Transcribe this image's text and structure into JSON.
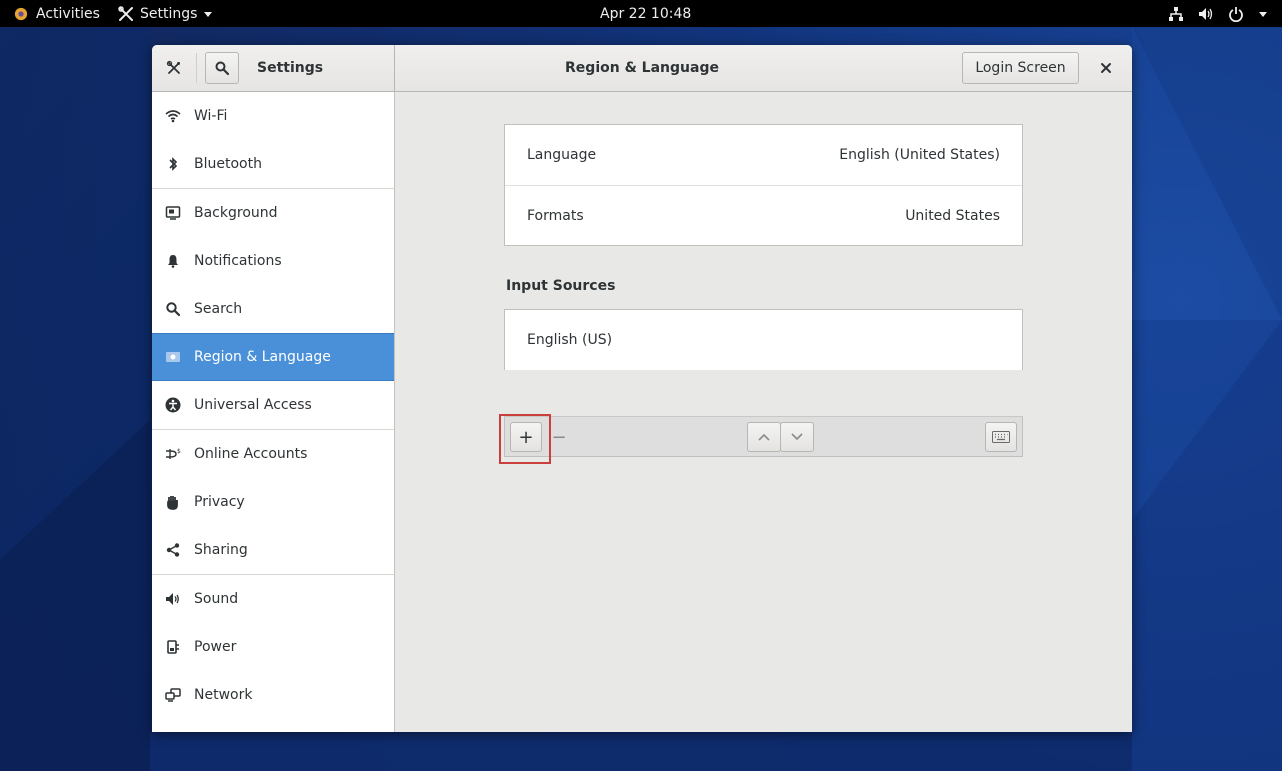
{
  "topbar": {
    "activities": "Activities",
    "app_menu": "Settings",
    "clock": "Apr 22  10:48"
  },
  "window": {
    "sidebar_title": "Settings",
    "panel_title": "Region & Language",
    "login_button": "Login Screen",
    "close_glyph": "×"
  },
  "sidebar": {
    "items": [
      {
        "label": "Wi-Fi",
        "icon": "wifi-icon"
      },
      {
        "label": "Bluetooth",
        "icon": "bluetooth-icon"
      },
      {
        "label": "Background",
        "icon": "background-icon"
      },
      {
        "label": "Notifications",
        "icon": "bell-icon"
      },
      {
        "label": "Search",
        "icon": "search-icon"
      },
      {
        "label": "Region & Language",
        "icon": "flag-icon",
        "selected": true
      },
      {
        "label": "Universal Access",
        "icon": "accessibility-icon"
      },
      {
        "label": "Online Accounts",
        "icon": "online-accounts-icon"
      },
      {
        "label": "Privacy",
        "icon": "hand-icon"
      },
      {
        "label": "Sharing",
        "icon": "share-icon"
      },
      {
        "label": "Sound",
        "icon": "speaker-icon"
      },
      {
        "label": "Power",
        "icon": "power-plug-icon"
      },
      {
        "label": "Network",
        "icon": "network-icon"
      }
    ]
  },
  "language_settings": {
    "rows": [
      {
        "key": "Language",
        "value": "English (United States)"
      },
      {
        "key": "Formats",
        "value": "United States"
      }
    ]
  },
  "input_sources": {
    "title": "Input Sources",
    "items": [
      "English (US)"
    ],
    "add_glyph": "+",
    "remove_glyph": "−"
  },
  "colors": {
    "accent": "#4a90d9",
    "highlight_box": "#c9403a",
    "topbar": "#000000"
  }
}
